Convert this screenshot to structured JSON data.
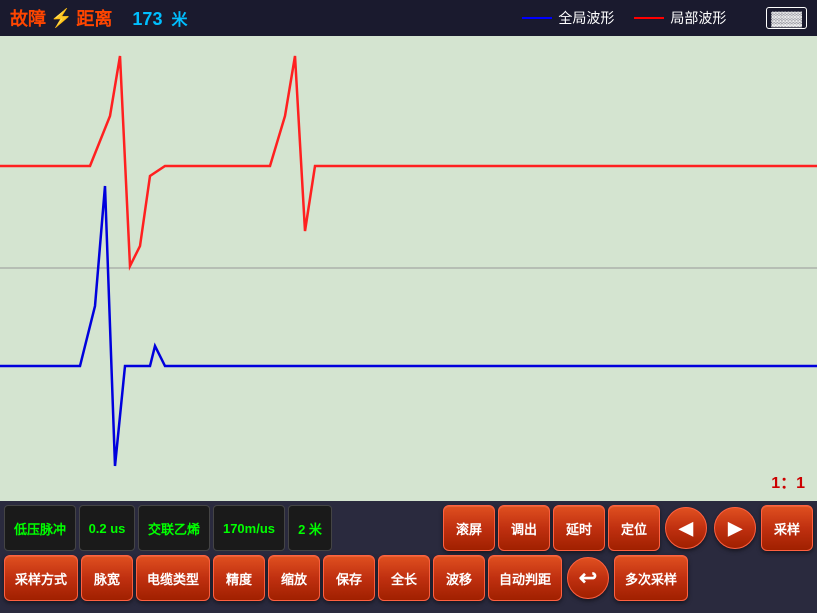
{
  "header": {
    "title": "故障",
    "lightning": "⚡",
    "distance_label": "距离",
    "distance_value": "173",
    "unit": "米",
    "legend": {
      "global_label": "全局波形",
      "local_label": "局部波形",
      "global_color": "#0000ff",
      "local_color": "#ff0000"
    },
    "battery": "🔋"
  },
  "chart": {
    "scale": "1：1",
    "bg_color": "#d4e4d0"
  },
  "controls": {
    "row1": {
      "info1": "低压脉冲",
      "info2": "0.2 us",
      "info3": "交联乙烯",
      "info4": "170m/us",
      "info5": "2 米",
      "btn1": "滚屏",
      "btn2": "调出",
      "btn3": "延时",
      "btn4": "定位",
      "btn5": "◀",
      "btn6": "▶",
      "btn7": "采样"
    },
    "row2": {
      "btn1": "采样方式",
      "btn2": "脉宽",
      "btn3": "电缆类型",
      "btn4": "精度",
      "btn5": "缩放",
      "btn6": "保存",
      "btn7": "全长",
      "btn8": "波移",
      "btn9": "自动判距",
      "btn10": "↩",
      "btn11": "多次采样"
    }
  }
}
